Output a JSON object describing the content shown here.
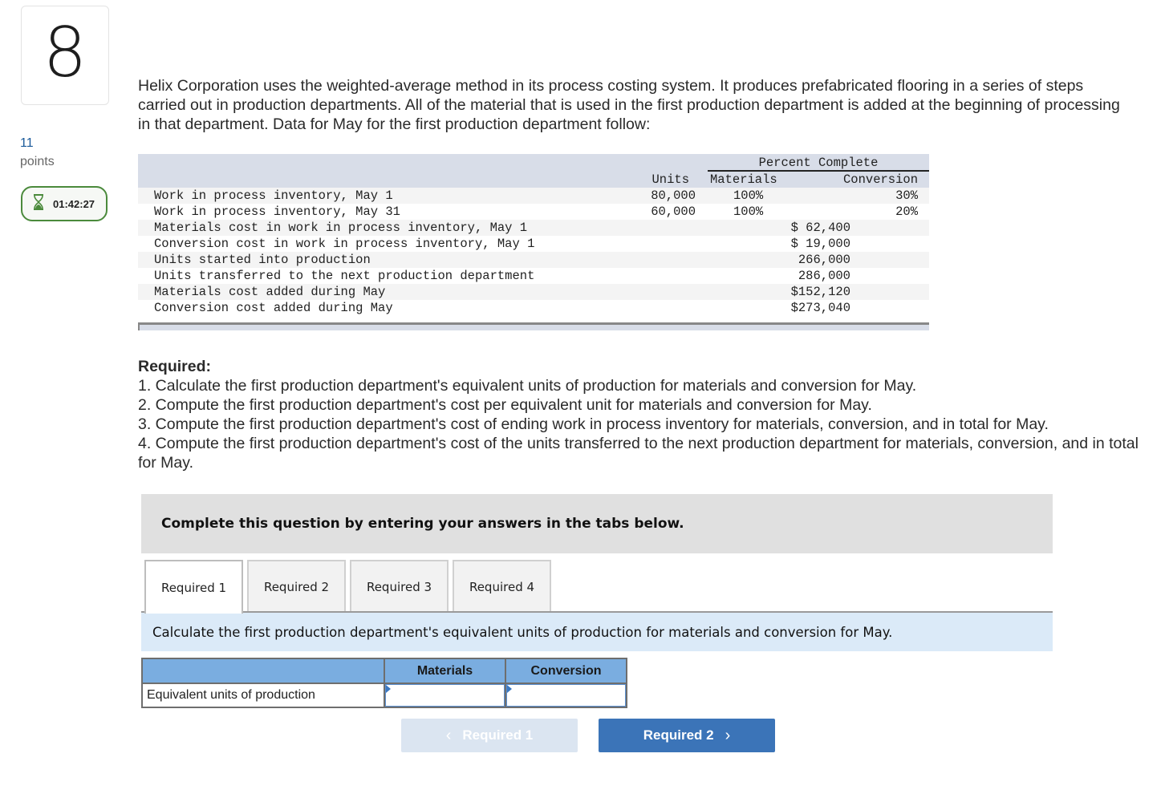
{
  "question": {
    "number": "8",
    "points_value": "11",
    "points_label": "points",
    "timer": "01:42:27"
  },
  "intro_text": "Helix Corporation uses the weighted-average method in its process costing system. It produces prefabricated flooring in a series of steps carried out in production departments. All of the material that is used in the first production department is added at the beginning of processing in that department. Data for May for the first production department follow:",
  "data_table": {
    "percent_complete_header": "Percent Complete",
    "col_units": "Units",
    "col_materials": "Materials",
    "col_conversion": "Conversion",
    "rows": [
      {
        "label": "Work in process inventory, May 1",
        "units": "80,000",
        "materials": "100%",
        "conversion": "30%",
        "value": ""
      },
      {
        "label": "Work in process inventory, May 31",
        "units": "60,000",
        "materials": "100%",
        "conversion": "20%",
        "value": ""
      },
      {
        "label": "Materials cost in work in process inventory, May 1",
        "units": "",
        "materials": "",
        "conversion": "",
        "value": "$ 62,400"
      },
      {
        "label": "Conversion cost in work in process inventory, May 1",
        "units": "",
        "materials": "",
        "conversion": "",
        "value": "$ 19,000"
      },
      {
        "label": "Units started into production",
        "units": "",
        "materials": "",
        "conversion": "",
        "value": "266,000"
      },
      {
        "label": "Units transferred to the next production department",
        "units": "",
        "materials": "",
        "conversion": "",
        "value": "286,000"
      },
      {
        "label": "Materials cost added during May",
        "units": "",
        "materials": "",
        "conversion": "",
        "value": "$152,120"
      },
      {
        "label": "Conversion cost added during May",
        "units": "",
        "materials": "",
        "conversion": "",
        "value": "$273,040"
      }
    ]
  },
  "required": {
    "title": "Required:",
    "items": [
      "1. Calculate the first production department's equivalent units of production for materials and conversion for May.",
      "2. Compute the first production department's cost per equivalent unit for materials and conversion for May.",
      "3. Compute the first production department's cost of ending work in process inventory for materials, conversion, and in total for May.",
      "4. Compute the first production department's cost of the units transferred to the next production department for materials, conversion, and in total for May."
    ]
  },
  "instruction": "Complete this question by entering your answers in the tabs below.",
  "tabs": [
    {
      "label": "Required 1",
      "active": true
    },
    {
      "label": "Required 2",
      "active": false
    },
    {
      "label": "Required 3",
      "active": false
    },
    {
      "label": "Required 4",
      "active": false
    }
  ],
  "tab_panel": {
    "description": "Calculate the first production department's equivalent units of production for materials and conversion for May.",
    "answer_table": {
      "headers": [
        "",
        "Materials",
        "Conversion"
      ],
      "row_label": "Equivalent units of production",
      "materials_value": "",
      "conversion_value": ""
    }
  },
  "nav": {
    "prev_label": "Required 1",
    "next_label": "Required 2"
  },
  "colors": {
    "points_blue": "#1b5a9a",
    "timer_green": "#4b8a3c",
    "table_header_bg": "#d8dde8",
    "instruction_bg": "#e0e0e0",
    "tab_panel_bg": "#dbeaf8",
    "answer_header_bg": "#7aade0",
    "next_button_bg": "#3b74b8",
    "prev_button_bg_disabled": "#dbe5f1"
  }
}
